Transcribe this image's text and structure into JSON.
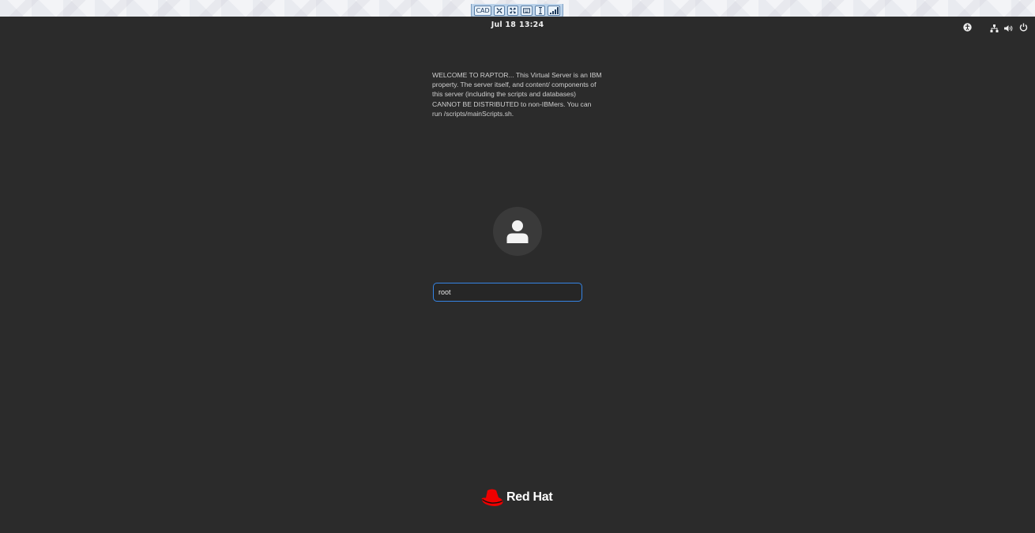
{
  "vnc_toolbar": {
    "cad_label": "CAD",
    "icons": [
      "fullscreen-exit-icon",
      "fullscreen-icon",
      "keyboard-icon",
      "text-cursor-icon",
      "signal-strength-icon"
    ]
  },
  "top_bar": {
    "date": "Jul 18",
    "time": "13:24",
    "tray_icons": [
      "accessibility-icon",
      "network-icon",
      "volume-icon",
      "power-icon"
    ]
  },
  "banner": {
    "text": "WELCOME TO RAPTOR... This Virtual Server is an IBM property. The server itself, and content/ components of this server (including the scripts and databases) CANNOT BE DISTRIBUTED to non-IBMers. You can run /scripts/mainScripts.sh."
  },
  "login": {
    "username_value": "root"
  },
  "brand": {
    "name": "Red Hat",
    "colors": {
      "logo_red": "#ee0000",
      "accent_focus": "#3584e4"
    }
  }
}
